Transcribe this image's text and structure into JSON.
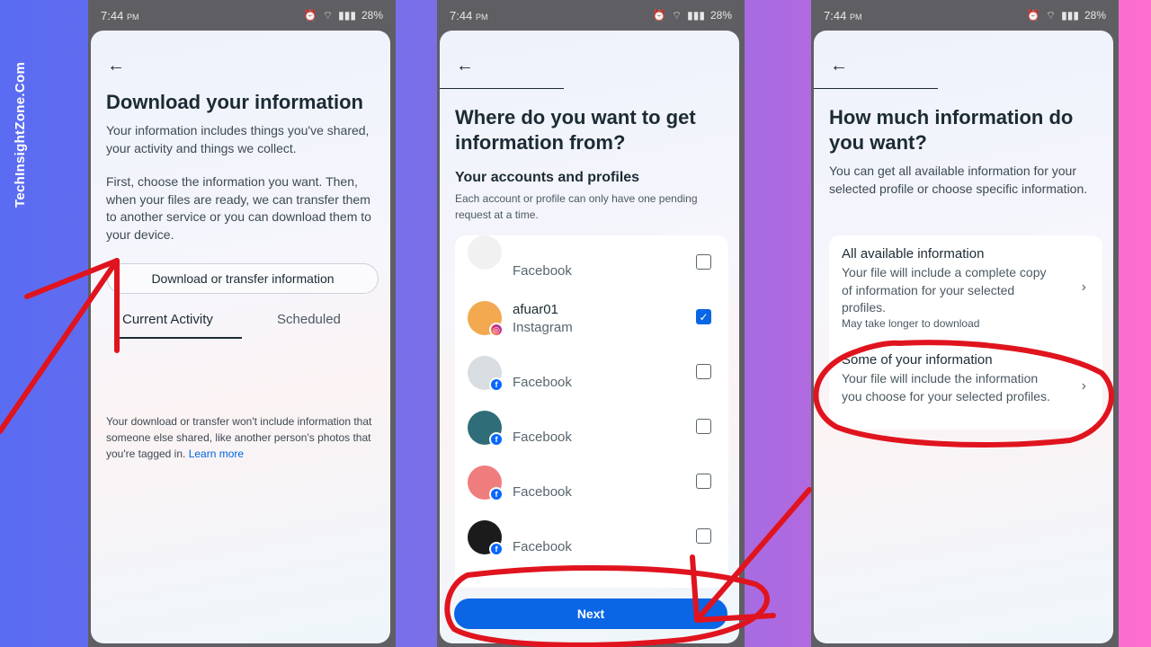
{
  "watermark": "TechInsightZone.Com",
  "statusbar": {
    "time1": "7:44",
    "time2": "7:44",
    "time3": "7:44",
    "ampm": "PM",
    "battery": "28%"
  },
  "screen1": {
    "title": "Download your information",
    "para1": "Your information includes things you've shared, your activity and things we collect.",
    "para2": "First, choose the information you want. Then, when your files are ready, we can transfer them to another service or you can download them to your device.",
    "button": "Download or transfer information",
    "tab_current": "Current Activity",
    "tab_scheduled": "Scheduled",
    "note": "Your download or transfer won't include information that someone else shared, like another person's photos that you're tagged in.",
    "learn_more": "Learn more"
  },
  "screen2": {
    "title": "Where do you want to get information from?",
    "subtitle": "Your accounts and profiles",
    "subnote": "Each account or profile can only have one pending request at a time.",
    "accounts": [
      {
        "name": "",
        "platform": "Facebook",
        "checked": false,
        "badge": "fb",
        "avatar_color": "#f1f1f1"
      },
      {
        "name": "afuar01",
        "platform": "Instagram",
        "checked": true,
        "badge": "ig",
        "avatar_color": "#f2a950"
      },
      {
        "name": "",
        "platform": "Facebook",
        "checked": false,
        "badge": "fb",
        "avatar_color": "#d8dde2"
      },
      {
        "name": "",
        "platform": "Facebook",
        "checked": false,
        "badge": "fb",
        "avatar_color": "#2f6e78"
      },
      {
        "name": "",
        "platform": "Facebook",
        "checked": false,
        "badge": "fb",
        "avatar_color": "#f07d7d"
      },
      {
        "name": "",
        "platform": "Facebook",
        "checked": false,
        "badge": "fb",
        "avatar_color": "#1b1b1b"
      }
    ],
    "next_button": "Next"
  },
  "screen3": {
    "title": "How much information do you want?",
    "para": "You can get all available information for your selected profile or choose specific information.",
    "option1": {
      "title": "All available information",
      "desc": "Your file will include a complete copy of information for your selected profiles.",
      "note": "May take longer to download"
    },
    "option2": {
      "title": "Some of your information",
      "desc": "Your file will include the information you choose for your selected profiles."
    }
  },
  "colors": {
    "accent": "#0a66e4",
    "annotation_red": "#e0141e",
    "phone_frame": "#5f5f63"
  }
}
